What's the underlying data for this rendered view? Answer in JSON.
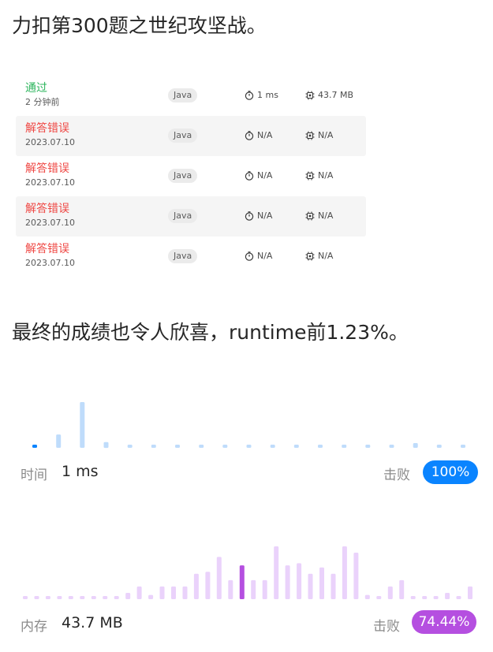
{
  "intro_text": "力扣第300题之世纪攻坚战。",
  "result_text": "最终的成绩也令人欣喜，runtime前1.23%。",
  "submissions": [
    {
      "status": "通过",
      "status_type": "ok",
      "time": "2 分钟前",
      "language": "Java",
      "runtime": "1 ms",
      "memory": "43.7 MB"
    },
    {
      "status": "解答错误",
      "status_type": "err",
      "time": "2023.07.10",
      "language": "Java",
      "runtime": "N/A",
      "memory": "N/A"
    },
    {
      "status": "解答错误",
      "status_type": "err",
      "time": "2023.07.10",
      "language": "Java",
      "runtime": "N/A",
      "memory": "N/A"
    },
    {
      "status": "解答错误",
      "status_type": "err",
      "time": "2023.07.10",
      "language": "Java",
      "runtime": "N/A",
      "memory": "N/A"
    },
    {
      "status": "解答错误",
      "status_type": "err",
      "time": "2023.07.10",
      "language": "Java",
      "runtime": "N/A",
      "memory": "N/A"
    }
  ],
  "runtime_stats": {
    "label": "时间",
    "value": "1 ms",
    "beats_label": "击败",
    "beats_pct": "100%",
    "accent": "#0a84ff",
    "bar_color": "#bfdcfb"
  },
  "memory_stats": {
    "label": "内存",
    "value": "43.7 MB",
    "beats_label": "击败",
    "beats_pct": "74.44%",
    "accent": "#b54fe0",
    "bar_color": "#ead2fb"
  },
  "chart_data": [
    {
      "type": "bar",
      "highlight_index": 0,
      "values": [
        2,
        14,
        48,
        6,
        1,
        1,
        1,
        1,
        1,
        1,
        1,
        1,
        1,
        1,
        1,
        1,
        5,
        1,
        1
      ]
    },
    {
      "type": "bar",
      "highlight_index": 19,
      "values": [
        1,
        1,
        1,
        1,
        1,
        1,
        1,
        1,
        1,
        3,
        6,
        2,
        6,
        6,
        6,
        12,
        13,
        20,
        9,
        16,
        9,
        9,
        25,
        16,
        17,
        12,
        15,
        12,
        25,
        22,
        2,
        1,
        6,
        9,
        1,
        1,
        1,
        3,
        1,
        6
      ]
    }
  ]
}
